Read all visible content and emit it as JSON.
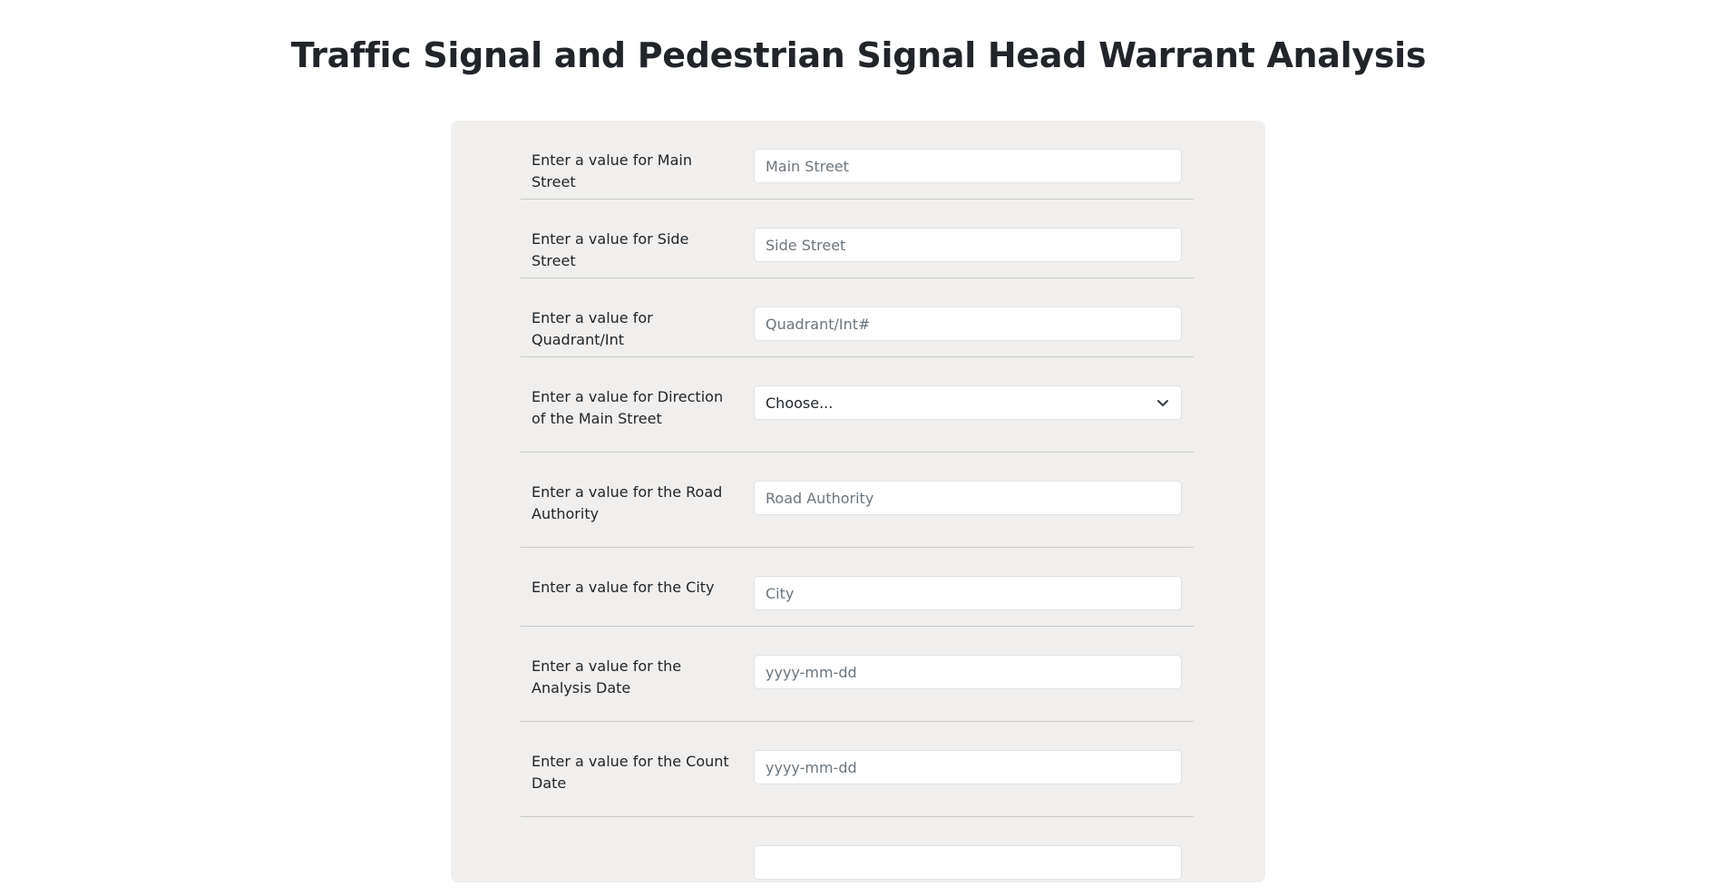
{
  "page": {
    "title": "Traffic Signal and Pedestrian Signal Head Warrant Analysis"
  },
  "form": {
    "main_street": {
      "label": "Enter a value for Main Street",
      "placeholder": "Main Street"
    },
    "side_street": {
      "label": "Enter a value for Side Street",
      "placeholder": "Side Street"
    },
    "quadrant": {
      "label": "Enter a value for Quadrant/Int",
      "placeholder": "Quadrant/Int#"
    },
    "direction": {
      "label": "Enter a value for Direction of the Main Street",
      "selected": "Choose..."
    },
    "road_authority": {
      "label": "Enter a value for the Road Authority",
      "placeholder": "Road Authority"
    },
    "city": {
      "label": "Enter a value for the City",
      "placeholder": "City"
    },
    "analysis_date": {
      "label": "Enter a value for the Analysis Date",
      "placeholder": "yyyy-mm-dd"
    },
    "count_date": {
      "label": "Enter a value for the Count Date",
      "placeholder": "yyyy-mm-dd"
    }
  },
  "icons": {
    "select_arrow": "chevron-down-icon"
  }
}
